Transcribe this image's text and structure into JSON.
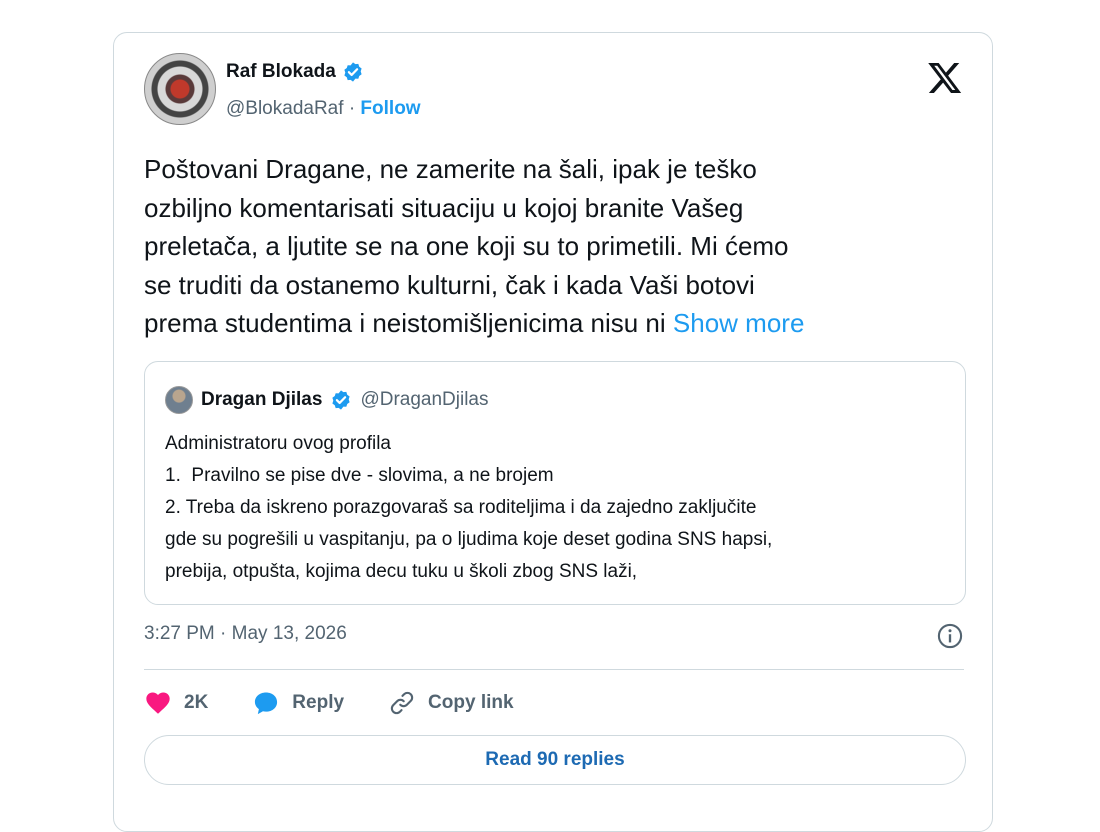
{
  "author": {
    "display_name": "Raf Blokada",
    "handle": "@BlokadaRaf",
    "separator": "·",
    "follow_label": "Follow"
  },
  "tweet": {
    "lines": [
      "Poštovani Dragane, ne zamerite na šali, ipak je teško",
      "ozbiljno komentarisati situaciju u kojoj branite Vašeg",
      "preletača, a ljutite se na one koji su to primetili. Mi ćemo",
      "se truditi da ostanemo kulturni, čak i kada Vaši botovi",
      "prema studentima i neistomišljenicima nisu ni"
    ],
    "show_more_label": "Show more"
  },
  "quote": {
    "display_name": "Dragan Djilas",
    "handle": "@DraganDjilas",
    "lines": [
      "Administratoru ovog profila",
      "1.  Pravilno se pise dve - slovima, a ne brojem",
      "2. Treba da iskreno porazgovaraš sa roditeljima i da zajedno zaključite",
      "gde su pogrešili u vaspitanju, pa o ljudima koje deset godina SNS hapsi,",
      "prebija, otpušta, kojima decu tuku u školi zbog SNS laži,"
    ]
  },
  "timestamp": "3:27 PM · May 13, 2026",
  "actions": {
    "like_count": "2K",
    "reply_label": "Reply",
    "copy_link_label": "Copy link"
  },
  "read_replies_label": "Read 90 replies",
  "colors": {
    "accent_blue": "#1d9bf0",
    "like_pink": "#f91880",
    "muted_text": "#536471",
    "border": "#cfd9de"
  },
  "icons": {
    "verified": "verified-badge-icon",
    "x_logo": "x-logo-icon",
    "info": "info-icon",
    "heart": "heart-icon",
    "reply": "speech-bubble-icon",
    "link": "link-icon"
  }
}
